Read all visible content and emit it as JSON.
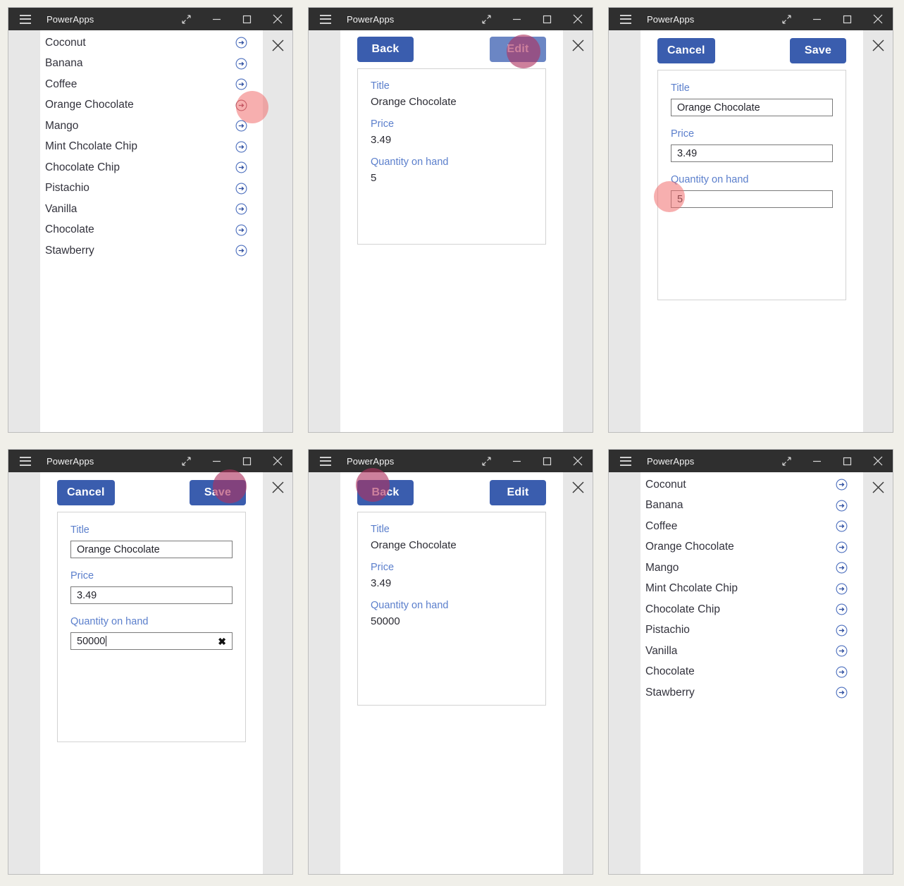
{
  "window": {
    "title": "PowerApps",
    "controls": [
      {
        "name": "menu-icon",
        "glyph": "hamburger"
      },
      {
        "name": "restore-expand-icon",
        "glyph": "expand"
      },
      {
        "name": "minimize-icon",
        "glyph": "minimize"
      },
      {
        "name": "maximize-icon",
        "glyph": "maximize"
      },
      {
        "name": "close-icon",
        "glyph": "close"
      }
    ],
    "app_close_icon": "close-icon"
  },
  "colors": {
    "titlebar_bg": "#2f2f2f",
    "app_bg": "#e7e7e7",
    "screen_bg": "#ffffff",
    "button_primary": "#3a5dae",
    "button_hover": "#6b86c4",
    "label_blue": "#5b7fcc",
    "text_dark": "#32323c",
    "click_indicator": "#f06e6e",
    "click_indicator_dark": "#af325f",
    "page_bg": "#f0efe9"
  },
  "list_screen": {
    "name": "browse-gallery",
    "items": [
      "Coconut",
      "Banana",
      "Coffee",
      "Orange Chocolate",
      "Mango",
      "Mint Chcolate Chip",
      "Chocolate Chip",
      "Pistachio",
      "Vanilla",
      "Chocolate",
      "Stawberry"
    ],
    "row_icon": "arrow-right-circle-icon"
  },
  "detail_screen": {
    "name": "detail-screen",
    "back_label": "Back",
    "edit_label": "Edit",
    "fields": [
      {
        "label": "Title",
        "value": "Orange Chocolate"
      },
      {
        "label": "Price",
        "value": "3.49"
      },
      {
        "label": "Quantity on hand",
        "value": "5"
      }
    ]
  },
  "detail_screen_after": {
    "name": "detail-screen-updated",
    "back_label": "Back",
    "edit_label": "Edit",
    "fields": [
      {
        "label": "Title",
        "value": "Orange Chocolate"
      },
      {
        "label": "Price",
        "value": "3.49"
      },
      {
        "label": "Quantity on hand",
        "value": "50000"
      }
    ]
  },
  "edit_screen": {
    "name": "edit-screen",
    "cancel_label": "Cancel",
    "save_label": "Save",
    "fields": [
      {
        "label": "Title",
        "value": "Orange Chocolate"
      },
      {
        "label": "Price",
        "value": "3.49"
      },
      {
        "label": "Quantity on hand",
        "value": "5"
      }
    ]
  },
  "edit_screen_typed": {
    "name": "edit-screen-typed",
    "cancel_label": "Cancel",
    "save_label": "Save",
    "clear_icon": "clear-x-icon",
    "fields": [
      {
        "label": "Title",
        "value": "Orange Chocolate"
      },
      {
        "label": "Price",
        "value": "3.49"
      },
      {
        "label": "Quantity on hand",
        "value": "50000"
      }
    ]
  },
  "panels": [
    {
      "step": 1,
      "screen": "list_screen",
      "click_target": "row-arrow-orange-chocolate"
    },
    {
      "step": 2,
      "screen": "detail_screen",
      "click_target": "edit-button"
    },
    {
      "step": 3,
      "screen": "edit_screen",
      "click_target": "quantity-on-hand-input"
    },
    {
      "step": 4,
      "screen": "edit_screen_typed",
      "click_target": "save-button"
    },
    {
      "step": 5,
      "screen": "detail_screen_after",
      "click_target": "back-button"
    },
    {
      "step": 6,
      "screen": "list_screen",
      "click_target": null
    }
  ]
}
